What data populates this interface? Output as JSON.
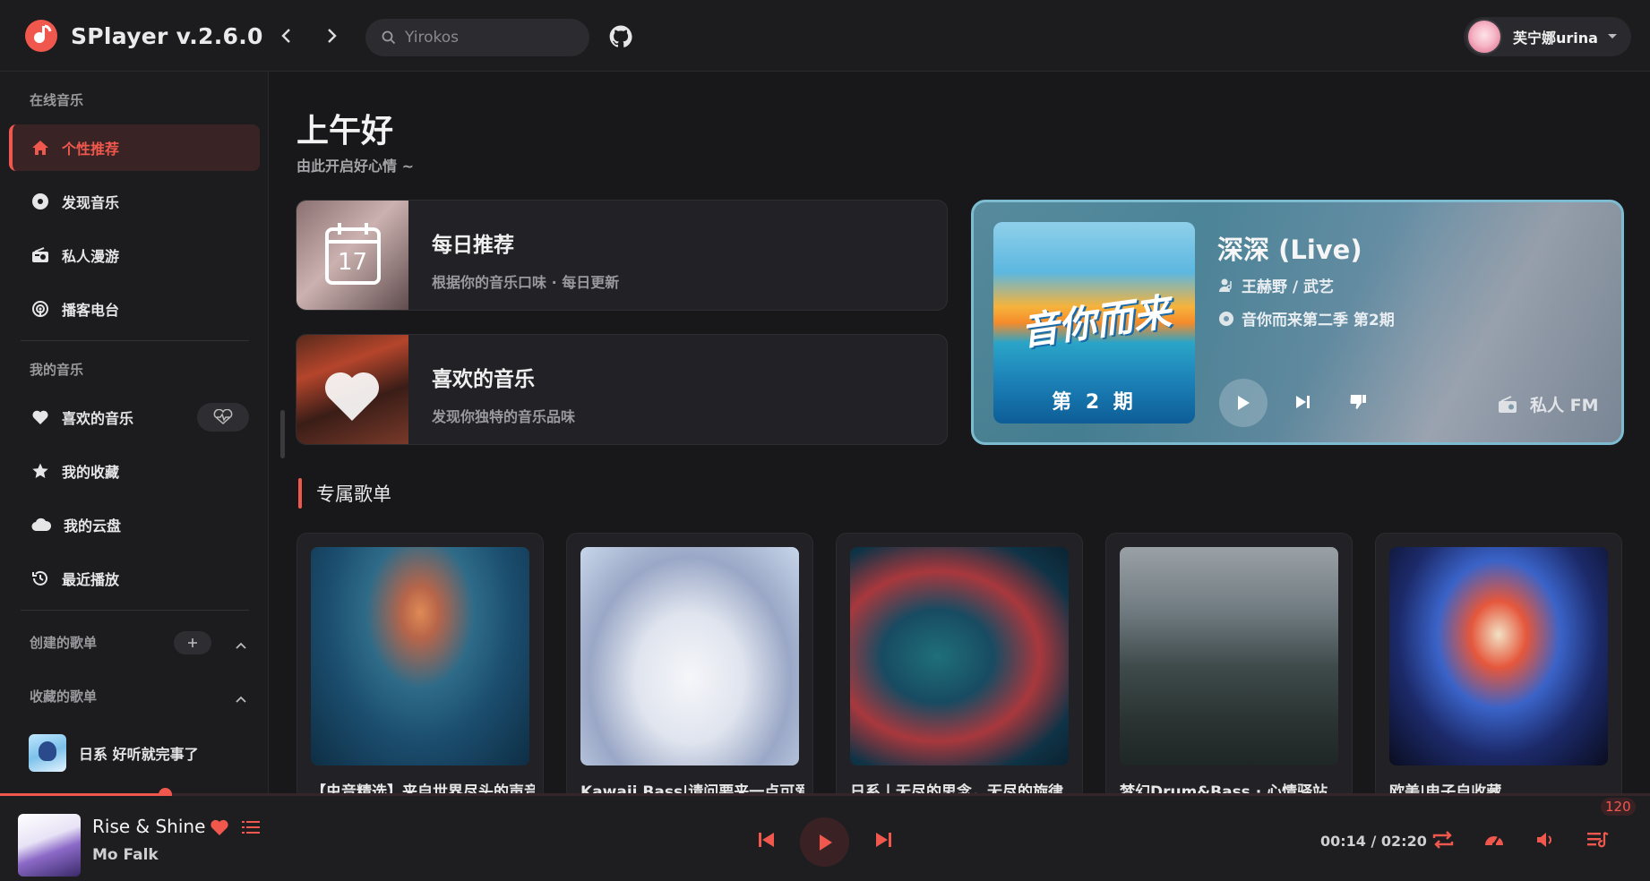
{
  "header": {
    "app_title": "SPlayer v.2.6.0",
    "search_placeholder": "Yirokos",
    "user_name": "芙宁娜urina"
  },
  "sidebar": {
    "online_title": "在线音乐",
    "online_items": [
      {
        "label": "个性推荐",
        "icon": "home-icon",
        "active": true
      },
      {
        "label": "发现音乐",
        "icon": "disc-icon"
      },
      {
        "label": "私人漫游",
        "icon": "radio-icon"
      },
      {
        "label": "播客电台",
        "icon": "podcast-icon"
      }
    ],
    "my_title": "我的音乐",
    "my_items": [
      {
        "label": "喜欢的音乐",
        "icon": "heart-icon"
      },
      {
        "label": "我的收藏",
        "icon": "star-icon"
      },
      {
        "label": "我的云盘",
        "icon": "cloud-icon"
      },
      {
        "label": "最近播放",
        "icon": "history-icon"
      }
    ],
    "created_title": "创建的歌单",
    "collected_title": "收藏的歌单",
    "collected_playlists": [
      {
        "label": "日系 好听就完事了"
      }
    ]
  },
  "main": {
    "greeting": "上午好",
    "greeting_sub": "由此开启好心情 ~",
    "cards": [
      {
        "title": "每日推荐",
        "subtitle": "根据你的音乐口味 · 每日更新",
        "calendar_day": "17"
      },
      {
        "title": "喜欢的音乐",
        "subtitle": "发现你独特的音乐品味"
      }
    ],
    "fm": {
      "title": "深深 (Live)",
      "artists": "王赫野 / 武艺",
      "album": "音你而来第二季 第2期",
      "label": "私人 FM",
      "cover_logo_text": "音你而来",
      "cover_episode": "第 2 期"
    },
    "section_title": "专属歌单",
    "playlists": [
      {
        "name": "【虫音精选】来自世界尽头的声音"
      },
      {
        "name": "Kawaii Bass|请问要来一点可爱的吗"
      },
      {
        "name": "日系丨无尽的思念，无尽的旋律"
      },
      {
        "name": "梦幻Drum&Bass · 心情驿站"
      },
      {
        "name": "欧美|电子自收藏"
      }
    ]
  },
  "player": {
    "song_title": "Rise & Shine",
    "artist": "Mo Falk",
    "time": "00:14 / 02:20",
    "progress_fraction": 0.1,
    "queue_count": "120"
  },
  "colors": {
    "accent": "#f0584e",
    "background": "#18181b",
    "panel": "#1c1c1f"
  }
}
